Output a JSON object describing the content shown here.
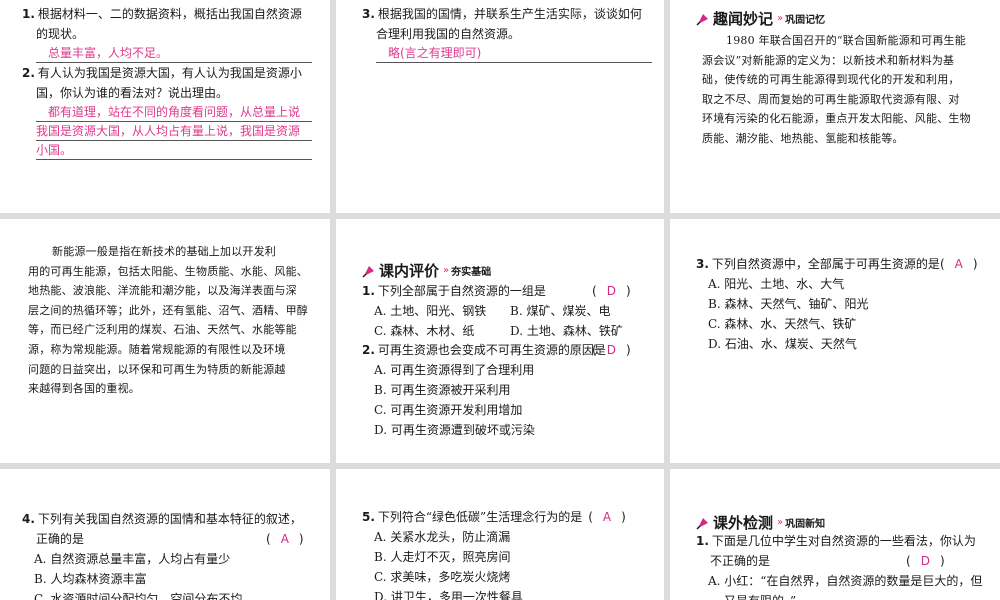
{
  "colors": {
    "accent": "#d32b86",
    "answer": "#e0388c"
  },
  "p1": {
    "q1": {
      "num": "1.",
      "lines": [
        "根据材料一、二的数据资料，概括出我国自然资源",
        "的现状。"
      ],
      "answer": "总量丰富，人均不足。"
    },
    "q2": {
      "num": "2.",
      "lines": [
        "有人认为我国是资源大国，有人认为我国是资源小",
        "国，你认为谁的看法对？说出理由。"
      ],
      "answers": [
        "都有道理，站在不同的角度看问题，从总量上说",
        "我国是资源大国，从人均占有量上说，我国是资源",
        "小国。"
      ]
    }
  },
  "p2": {
    "q3": {
      "num": "3.",
      "lines": [
        "根据我国的国情，并联系生产生活实际，谈谈如何",
        "合理利用我国的自然资源。"
      ],
      "answer": "略(言之有理即可)"
    }
  },
  "p3": {
    "header": {
      "icon": "bulb-icon",
      "title": "趣闻妙记",
      "subtitle": "巩固记忆"
    },
    "lines": [
      "1980 年联合国召开的“联合国新能源和可再生能",
      "源会议”对新能源的定义为：以新技术和新材料为基",
      "础，使传统的可再生能源得到现代化的开发和利用，",
      "取之不尽、周而复始的可再生能源取代资源有限、对",
      "环境有污染的化石能源，重点开发太阳能、风能、生物",
      "质能、潮汐能、地热能、氢能和核能等。"
    ]
  },
  "p4": {
    "lines": [
      "新能源一般是指在新技术的基础上加以开发利",
      "用的可再生能源，包括太阳能、生物质能、水能、风能、",
      "地热能、波浪能、洋流能和潮汐能，以及海洋表面与深",
      "层之间的热循环等；此外，还有氢能、沼气、酒精、甲醇",
      "等，而已经广泛利用的煤炭、石油、天然气、水能等能",
      "源，称为常规能源。随着常规能源的有限性以及环境",
      "问题的日益突出，以环保和可再生为特质的新能源越",
      "来越得到各国的重视。"
    ]
  },
  "p5": {
    "header": {
      "icon": "bulb-icon",
      "title": "课内评价",
      "subtitle": "夯实基础"
    },
    "q1": {
      "num": "1.",
      "stem": "下列全部属于自然资源的一组是",
      "answer": "D",
      "options": [
        "A. 土地、阳光、钢铁",
        "B. 煤矿、煤炭、电",
        "C. 森林、木材、纸",
        "D. 土地、森林、铁矿"
      ]
    },
    "q2": {
      "num": "2.",
      "stem": "可再生资源也会变成不可再生资源的原因是",
      "answer": "D",
      "options": [
        "A. 可再生资源得到了合理利用",
        "B. 可再生资源被开采利用",
        "C. 可再生资源开发利用增加",
        "D. 可再生资源遭到破坏或污染"
      ]
    }
  },
  "p6": {
    "q3": {
      "num": "3.",
      "stem": "下列自然资源中，全部属于可再生资源的是",
      "answer": "A",
      "options": [
        "A. 阳光、土地、水、大气",
        "B. 森林、天然气、铀矿、阳光",
        "C. 森林、水、天然气、铁矿",
        "D. 石油、水、煤炭、天然气"
      ]
    }
  },
  "p7": {
    "q4": {
      "num": "4.",
      "lines": [
        "下列有关我国自然资源的国情和基本特征的叙述，",
        "正确的是"
      ],
      "answer": "A",
      "options": [
        "A. 自然资源总量丰富，人均占有量少",
        "B. 人均森林资源丰富",
        "C. 水资源时间分配均匀，空间分布不均"
      ]
    }
  },
  "p8": {
    "q5": {
      "num": "5.",
      "stem": "下列符合“绿色低碳”生活理念行为的是",
      "answer": "A",
      "options": [
        "A. 关紧水龙头，防止滴漏",
        "B. 人走灯不灭，照亮房间",
        "C. 求美味，多吃炭火烧烤",
        "D. 讲卫生，多用一次性餐具"
      ]
    }
  },
  "p9": {
    "header": {
      "icon": "bulb-icon",
      "title": "课外检测",
      "subtitle": "巩固新知"
    },
    "q1": {
      "num": "1.",
      "lines": [
        "下面是几位中学生对自然资源的一些看法，你认为",
        "不正确的是"
      ],
      "answer": "D",
      "options": [
        "A. 小红：“在自然界，自然资源的数量是巨大的，但",
        "又是有限的。”"
      ]
    }
  }
}
